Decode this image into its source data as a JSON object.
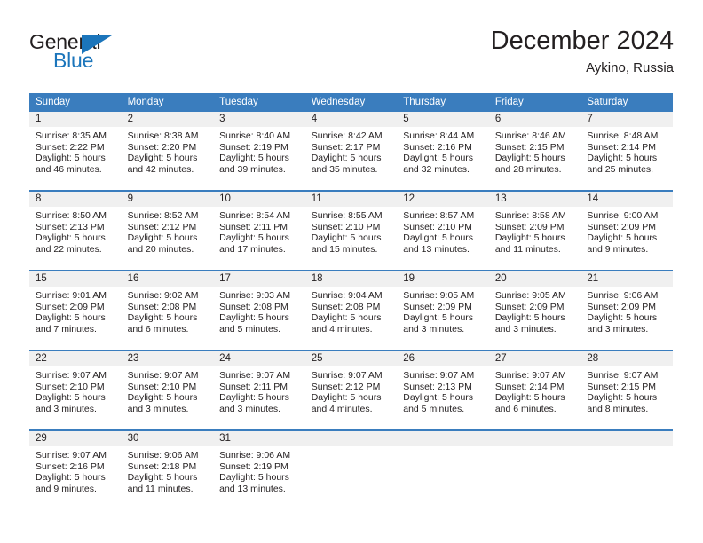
{
  "brand": {
    "name_part1": "General",
    "name_part2": "Blue",
    "mark": "triangle-logo"
  },
  "header": {
    "title": "December 2024",
    "location": "Aykino, Russia"
  },
  "colors": {
    "header_blue": "#3a7dbe",
    "brand_blue": "#1b75bb",
    "daynum_band": "#f0f0f0",
    "text": "#231f20"
  },
  "weekday_headers": [
    "Sunday",
    "Monday",
    "Tuesday",
    "Wednesday",
    "Thursday",
    "Friday",
    "Saturday"
  ],
  "weeks": [
    [
      {
        "day": "1",
        "sunrise": "Sunrise: 8:35 AM",
        "sunset": "Sunset: 2:22 PM",
        "daylight_1": "Daylight: 5 hours",
        "daylight_2": "and 46 minutes."
      },
      {
        "day": "2",
        "sunrise": "Sunrise: 8:38 AM",
        "sunset": "Sunset: 2:20 PM",
        "daylight_1": "Daylight: 5 hours",
        "daylight_2": "and 42 minutes."
      },
      {
        "day": "3",
        "sunrise": "Sunrise: 8:40 AM",
        "sunset": "Sunset: 2:19 PM",
        "daylight_1": "Daylight: 5 hours",
        "daylight_2": "and 39 minutes."
      },
      {
        "day": "4",
        "sunrise": "Sunrise: 8:42 AM",
        "sunset": "Sunset: 2:17 PM",
        "daylight_1": "Daylight: 5 hours",
        "daylight_2": "and 35 minutes."
      },
      {
        "day": "5",
        "sunrise": "Sunrise: 8:44 AM",
        "sunset": "Sunset: 2:16 PM",
        "daylight_1": "Daylight: 5 hours",
        "daylight_2": "and 32 minutes."
      },
      {
        "day": "6",
        "sunrise": "Sunrise: 8:46 AM",
        "sunset": "Sunset: 2:15 PM",
        "daylight_1": "Daylight: 5 hours",
        "daylight_2": "and 28 minutes."
      },
      {
        "day": "7",
        "sunrise": "Sunrise: 8:48 AM",
        "sunset": "Sunset: 2:14 PM",
        "daylight_1": "Daylight: 5 hours",
        "daylight_2": "and 25 minutes."
      }
    ],
    [
      {
        "day": "8",
        "sunrise": "Sunrise: 8:50 AM",
        "sunset": "Sunset: 2:13 PM",
        "daylight_1": "Daylight: 5 hours",
        "daylight_2": "and 22 minutes."
      },
      {
        "day": "9",
        "sunrise": "Sunrise: 8:52 AM",
        "sunset": "Sunset: 2:12 PM",
        "daylight_1": "Daylight: 5 hours",
        "daylight_2": "and 20 minutes."
      },
      {
        "day": "10",
        "sunrise": "Sunrise: 8:54 AM",
        "sunset": "Sunset: 2:11 PM",
        "daylight_1": "Daylight: 5 hours",
        "daylight_2": "and 17 minutes."
      },
      {
        "day": "11",
        "sunrise": "Sunrise: 8:55 AM",
        "sunset": "Sunset: 2:10 PM",
        "daylight_1": "Daylight: 5 hours",
        "daylight_2": "and 15 minutes."
      },
      {
        "day": "12",
        "sunrise": "Sunrise: 8:57 AM",
        "sunset": "Sunset: 2:10 PM",
        "daylight_1": "Daylight: 5 hours",
        "daylight_2": "and 13 minutes."
      },
      {
        "day": "13",
        "sunrise": "Sunrise: 8:58 AM",
        "sunset": "Sunset: 2:09 PM",
        "daylight_1": "Daylight: 5 hours",
        "daylight_2": "and 11 minutes."
      },
      {
        "day": "14",
        "sunrise": "Sunrise: 9:00 AM",
        "sunset": "Sunset: 2:09 PM",
        "daylight_1": "Daylight: 5 hours",
        "daylight_2": "and 9 minutes."
      }
    ],
    [
      {
        "day": "15",
        "sunrise": "Sunrise: 9:01 AM",
        "sunset": "Sunset: 2:09 PM",
        "daylight_1": "Daylight: 5 hours",
        "daylight_2": "and 7 minutes."
      },
      {
        "day": "16",
        "sunrise": "Sunrise: 9:02 AM",
        "sunset": "Sunset: 2:08 PM",
        "daylight_1": "Daylight: 5 hours",
        "daylight_2": "and 6 minutes."
      },
      {
        "day": "17",
        "sunrise": "Sunrise: 9:03 AM",
        "sunset": "Sunset: 2:08 PM",
        "daylight_1": "Daylight: 5 hours",
        "daylight_2": "and 5 minutes."
      },
      {
        "day": "18",
        "sunrise": "Sunrise: 9:04 AM",
        "sunset": "Sunset: 2:08 PM",
        "daylight_1": "Daylight: 5 hours",
        "daylight_2": "and 4 minutes."
      },
      {
        "day": "19",
        "sunrise": "Sunrise: 9:05 AM",
        "sunset": "Sunset: 2:09 PM",
        "daylight_1": "Daylight: 5 hours",
        "daylight_2": "and 3 minutes."
      },
      {
        "day": "20",
        "sunrise": "Sunrise: 9:05 AM",
        "sunset": "Sunset: 2:09 PM",
        "daylight_1": "Daylight: 5 hours",
        "daylight_2": "and 3 minutes."
      },
      {
        "day": "21",
        "sunrise": "Sunrise: 9:06 AM",
        "sunset": "Sunset: 2:09 PM",
        "daylight_1": "Daylight: 5 hours",
        "daylight_2": "and 3 minutes."
      }
    ],
    [
      {
        "day": "22",
        "sunrise": "Sunrise: 9:07 AM",
        "sunset": "Sunset: 2:10 PM",
        "daylight_1": "Daylight: 5 hours",
        "daylight_2": "and 3 minutes."
      },
      {
        "day": "23",
        "sunrise": "Sunrise: 9:07 AM",
        "sunset": "Sunset: 2:10 PM",
        "daylight_1": "Daylight: 5 hours",
        "daylight_2": "and 3 minutes."
      },
      {
        "day": "24",
        "sunrise": "Sunrise: 9:07 AM",
        "sunset": "Sunset: 2:11 PM",
        "daylight_1": "Daylight: 5 hours",
        "daylight_2": "and 3 minutes."
      },
      {
        "day": "25",
        "sunrise": "Sunrise: 9:07 AM",
        "sunset": "Sunset: 2:12 PM",
        "daylight_1": "Daylight: 5 hours",
        "daylight_2": "and 4 minutes."
      },
      {
        "day": "26",
        "sunrise": "Sunrise: 9:07 AM",
        "sunset": "Sunset: 2:13 PM",
        "daylight_1": "Daylight: 5 hours",
        "daylight_2": "and 5 minutes."
      },
      {
        "day": "27",
        "sunrise": "Sunrise: 9:07 AM",
        "sunset": "Sunset: 2:14 PM",
        "daylight_1": "Daylight: 5 hours",
        "daylight_2": "and 6 minutes."
      },
      {
        "day": "28",
        "sunrise": "Sunrise: 9:07 AM",
        "sunset": "Sunset: 2:15 PM",
        "daylight_1": "Daylight: 5 hours",
        "daylight_2": "and 8 minutes."
      }
    ],
    [
      {
        "day": "29",
        "sunrise": "Sunrise: 9:07 AM",
        "sunset": "Sunset: 2:16 PM",
        "daylight_1": "Daylight: 5 hours",
        "daylight_2": "and 9 minutes."
      },
      {
        "day": "30",
        "sunrise": "Sunrise: 9:06 AM",
        "sunset": "Sunset: 2:18 PM",
        "daylight_1": "Daylight: 5 hours",
        "daylight_2": "and 11 minutes."
      },
      {
        "day": "31",
        "sunrise": "Sunrise: 9:06 AM",
        "sunset": "Sunset: 2:19 PM",
        "daylight_1": "Daylight: 5 hours",
        "daylight_2": "and 13 minutes."
      },
      {
        "day": "",
        "sunrise": "",
        "sunset": "",
        "daylight_1": "",
        "daylight_2": ""
      },
      {
        "day": "",
        "sunrise": "",
        "sunset": "",
        "daylight_1": "",
        "daylight_2": ""
      },
      {
        "day": "",
        "sunrise": "",
        "sunset": "",
        "daylight_1": "",
        "daylight_2": ""
      },
      {
        "day": "",
        "sunrise": "",
        "sunset": "",
        "daylight_1": "",
        "daylight_2": ""
      }
    ]
  ]
}
